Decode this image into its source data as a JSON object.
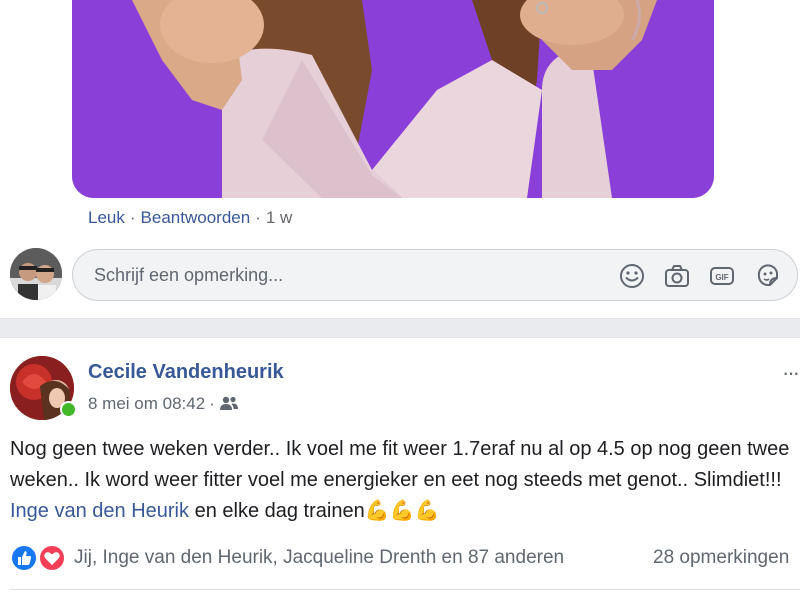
{
  "comment": {
    "actions": {
      "like": "Leuk",
      "reply": "Beantwoorden",
      "age": "1 w"
    }
  },
  "composer": {
    "placeholder": "Schrijf een opmerking...",
    "icons": [
      "emoji-icon",
      "camera-icon",
      "gif-icon",
      "sticker-icon"
    ]
  },
  "post": {
    "author": "Cecile Vandenheurik",
    "date": "8 mei om 08:42",
    "audience_icon": "friends-icon",
    "more_label": "···",
    "text_before": "Nog geen twee weken verder.. Ik voel me fit weer 1.7eraf nu al op 4.5 op nog geen twee weken.. Ik word weer fitter voel me energieker en eet nog steeds met genot.. Slimdiet!!! ",
    "mention": "Inge van den Heurik",
    "text_after": " en elke dag trainen",
    "emoji": "💪💪💪",
    "reactions": {
      "types": [
        "like",
        "love"
      ],
      "names": "Jij, Inge van den Heurik, Jacqueline Drenth en 87 anderen",
      "comments": "28 opmerkingen"
    }
  },
  "colors": {
    "link": "#385898",
    "photo_bg": "#8b3fd9",
    "online": "#42b72a",
    "like": "#1877f2",
    "love": "#f33e58"
  }
}
